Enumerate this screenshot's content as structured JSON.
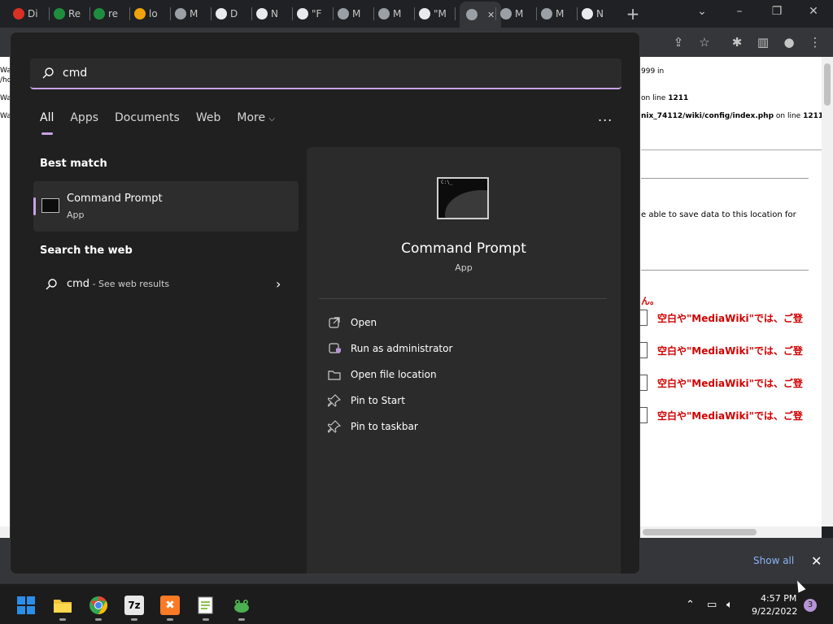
{
  "browser": {
    "tabs": [
      {
        "label": "Di",
        "icon": "opera-icon",
        "color": "#d93025"
      },
      {
        "label": "Re",
        "icon": "git-icon",
        "color": "#1e8e3e"
      },
      {
        "label": "re",
        "icon": "git-icon",
        "color": "#1e8e3e"
      },
      {
        "label": "lo",
        "icon": "phpmyadmin-icon",
        "color": "#f0a30a"
      },
      {
        "label": "M",
        "icon": "globe-icon",
        "color": "#9aa0a6"
      },
      {
        "label": "D",
        "icon": "download-icon",
        "color": "#e8eaed"
      },
      {
        "label": "N",
        "icon": "chrome-icon",
        "color": "#e8eaed"
      },
      {
        "label": "\"F",
        "icon": "google-icon",
        "color": "#e8eaed"
      },
      {
        "label": "M",
        "icon": "globe-icon",
        "color": "#9aa0a6"
      },
      {
        "label": "M",
        "icon": "globe-icon",
        "color": "#9aa0a6"
      },
      {
        "label": "\"M",
        "icon": "google-icon",
        "color": "#e8eaed"
      },
      {
        "label": "",
        "icon": "globe-icon",
        "color": "#9aa0a6"
      },
      {
        "label": "M",
        "icon": "globe-icon",
        "color": "#9aa0a6"
      },
      {
        "label": "M",
        "icon": "globe-icon",
        "color": "#9aa0a6"
      },
      {
        "label": "N",
        "icon": "chrome-icon",
        "color": "#e8eaed"
      }
    ],
    "new_tab": "+",
    "page": {
      "lines": [
        {
          "pre": "999 in",
          "bold": ""
        },
        {
          "pre": "on line ",
          "bold": "1211"
        },
        {
          "pre": "nix_74112/wiki/config/index.php",
          "post": " on line ",
          "bold": "1211"
        },
        {
          "pre": "e able to save data to this location for",
          "bold": ""
        },
        {
          "pre": "ん。",
          "bold": ""
        }
      ],
      "left_fragments": [
        "Wa",
        "/ho",
        "Wa",
        "Wa"
      ],
      "red_labels": [
        "空白や\"MediaWiki\"では、ご登",
        "空白や\"MediaWiki\"では、ご登",
        "空白や\"MediaWiki\"では、ご登",
        "空白や\"MediaWiki\"では、ご登"
      ]
    },
    "downloads": {
      "show_all": "Show all",
      "close": "✕"
    }
  },
  "search": {
    "query": "cmd",
    "filters": [
      "All",
      "Apps",
      "Documents",
      "Web",
      "More"
    ],
    "active_filter": "All",
    "more_menu": "...",
    "best_match_title": "Best match",
    "best_match": {
      "name": "Command Prompt",
      "kind": "App"
    },
    "web_title": "Search the web",
    "web_result": {
      "query": "cmd",
      "suffix": " - See web results"
    },
    "detail": {
      "name": "Command Prompt",
      "kind": "App",
      "actions": [
        {
          "label": "Open",
          "icon": "open-external-icon"
        },
        {
          "label": "Run as administrator",
          "icon": "shield-admin-icon"
        },
        {
          "label": "Open file location",
          "icon": "folder-icon"
        },
        {
          "label": "Pin to Start",
          "icon": "pin-icon"
        },
        {
          "label": "Pin to taskbar",
          "icon": "pin-icon"
        }
      ]
    },
    "accent_color": "#c9a2e6"
  },
  "taskbar": {
    "apps": [
      {
        "name": "start-icon",
        "color": "#2b8ee8"
      },
      {
        "name": "file-explorer-icon",
        "color": "#f0c33c"
      },
      {
        "name": "chrome-icon",
        "color": "#34a853"
      },
      {
        "name": "7zip-icon",
        "color": "#e8e8e8"
      },
      {
        "name": "xampp-icon",
        "color": "#fb7a24"
      },
      {
        "name": "notepadpp-icon",
        "color": "#8bc34a"
      },
      {
        "name": "frog-app-icon",
        "color": "#4caf50"
      }
    ],
    "time": "4:57 PM",
    "date": "9/22/2022",
    "notifications": "3"
  }
}
